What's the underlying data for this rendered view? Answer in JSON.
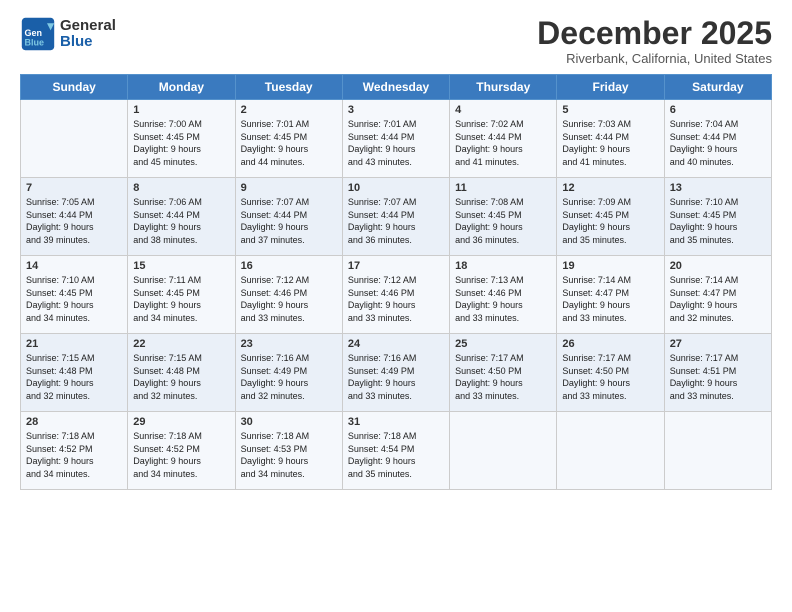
{
  "header": {
    "logo_general": "General",
    "logo_blue": "Blue",
    "month_title": "December 2025",
    "location": "Riverbank, California, United States"
  },
  "days_of_week": [
    "Sunday",
    "Monday",
    "Tuesday",
    "Wednesday",
    "Thursday",
    "Friday",
    "Saturday"
  ],
  "weeks": [
    [
      {
        "day": "",
        "content": ""
      },
      {
        "day": "1",
        "content": "Sunrise: 7:00 AM\nSunset: 4:45 PM\nDaylight: 9 hours\nand 45 minutes."
      },
      {
        "day": "2",
        "content": "Sunrise: 7:01 AM\nSunset: 4:45 PM\nDaylight: 9 hours\nand 44 minutes."
      },
      {
        "day": "3",
        "content": "Sunrise: 7:01 AM\nSunset: 4:44 PM\nDaylight: 9 hours\nand 43 minutes."
      },
      {
        "day": "4",
        "content": "Sunrise: 7:02 AM\nSunset: 4:44 PM\nDaylight: 9 hours\nand 41 minutes."
      },
      {
        "day": "5",
        "content": "Sunrise: 7:03 AM\nSunset: 4:44 PM\nDaylight: 9 hours\nand 41 minutes."
      },
      {
        "day": "6",
        "content": "Sunrise: 7:04 AM\nSunset: 4:44 PM\nDaylight: 9 hours\nand 40 minutes."
      }
    ],
    [
      {
        "day": "7",
        "content": "Sunrise: 7:05 AM\nSunset: 4:44 PM\nDaylight: 9 hours\nand 39 minutes."
      },
      {
        "day": "8",
        "content": "Sunrise: 7:06 AM\nSunset: 4:44 PM\nDaylight: 9 hours\nand 38 minutes."
      },
      {
        "day": "9",
        "content": "Sunrise: 7:07 AM\nSunset: 4:44 PM\nDaylight: 9 hours\nand 37 minutes."
      },
      {
        "day": "10",
        "content": "Sunrise: 7:07 AM\nSunset: 4:44 PM\nDaylight: 9 hours\nand 36 minutes."
      },
      {
        "day": "11",
        "content": "Sunrise: 7:08 AM\nSunset: 4:45 PM\nDaylight: 9 hours\nand 36 minutes."
      },
      {
        "day": "12",
        "content": "Sunrise: 7:09 AM\nSunset: 4:45 PM\nDaylight: 9 hours\nand 35 minutes."
      },
      {
        "day": "13",
        "content": "Sunrise: 7:10 AM\nSunset: 4:45 PM\nDaylight: 9 hours\nand 35 minutes."
      }
    ],
    [
      {
        "day": "14",
        "content": "Sunrise: 7:10 AM\nSunset: 4:45 PM\nDaylight: 9 hours\nand 34 minutes."
      },
      {
        "day": "15",
        "content": "Sunrise: 7:11 AM\nSunset: 4:45 PM\nDaylight: 9 hours\nand 34 minutes."
      },
      {
        "day": "16",
        "content": "Sunrise: 7:12 AM\nSunset: 4:46 PM\nDaylight: 9 hours\nand 33 minutes."
      },
      {
        "day": "17",
        "content": "Sunrise: 7:12 AM\nSunset: 4:46 PM\nDaylight: 9 hours\nand 33 minutes."
      },
      {
        "day": "18",
        "content": "Sunrise: 7:13 AM\nSunset: 4:46 PM\nDaylight: 9 hours\nand 33 minutes."
      },
      {
        "day": "19",
        "content": "Sunrise: 7:14 AM\nSunset: 4:47 PM\nDaylight: 9 hours\nand 33 minutes."
      },
      {
        "day": "20",
        "content": "Sunrise: 7:14 AM\nSunset: 4:47 PM\nDaylight: 9 hours\nand 32 minutes."
      }
    ],
    [
      {
        "day": "21",
        "content": "Sunrise: 7:15 AM\nSunset: 4:48 PM\nDaylight: 9 hours\nand 32 minutes."
      },
      {
        "day": "22",
        "content": "Sunrise: 7:15 AM\nSunset: 4:48 PM\nDaylight: 9 hours\nand 32 minutes."
      },
      {
        "day": "23",
        "content": "Sunrise: 7:16 AM\nSunset: 4:49 PM\nDaylight: 9 hours\nand 32 minutes."
      },
      {
        "day": "24",
        "content": "Sunrise: 7:16 AM\nSunset: 4:49 PM\nDaylight: 9 hours\nand 33 minutes."
      },
      {
        "day": "25",
        "content": "Sunrise: 7:17 AM\nSunset: 4:50 PM\nDaylight: 9 hours\nand 33 minutes."
      },
      {
        "day": "26",
        "content": "Sunrise: 7:17 AM\nSunset: 4:50 PM\nDaylight: 9 hours\nand 33 minutes."
      },
      {
        "day": "27",
        "content": "Sunrise: 7:17 AM\nSunset: 4:51 PM\nDaylight: 9 hours\nand 33 minutes."
      }
    ],
    [
      {
        "day": "28",
        "content": "Sunrise: 7:18 AM\nSunset: 4:52 PM\nDaylight: 9 hours\nand 34 minutes."
      },
      {
        "day": "29",
        "content": "Sunrise: 7:18 AM\nSunset: 4:52 PM\nDaylight: 9 hours\nand 34 minutes."
      },
      {
        "day": "30",
        "content": "Sunrise: 7:18 AM\nSunset: 4:53 PM\nDaylight: 9 hours\nand 34 minutes."
      },
      {
        "day": "31",
        "content": "Sunrise: 7:18 AM\nSunset: 4:54 PM\nDaylight: 9 hours\nand 35 minutes."
      },
      {
        "day": "",
        "content": ""
      },
      {
        "day": "",
        "content": ""
      },
      {
        "day": "",
        "content": ""
      }
    ]
  ]
}
